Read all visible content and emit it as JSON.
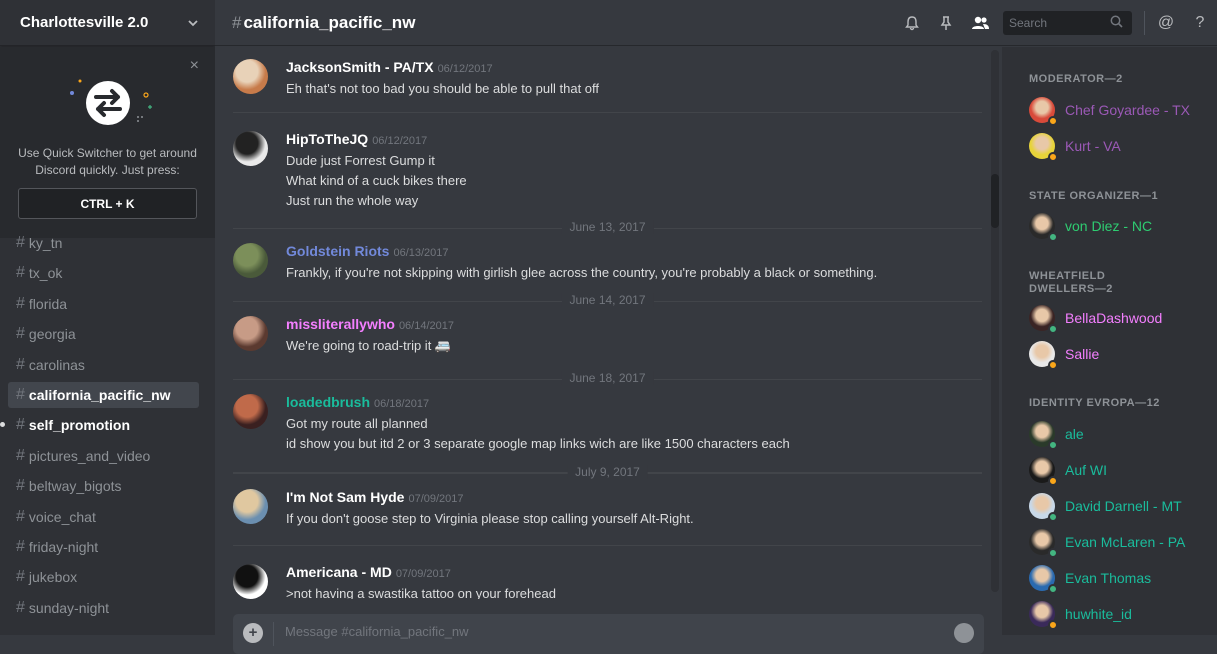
{
  "server": {
    "name": "Charlottesville 2.0"
  },
  "quick_switcher": {
    "text": "Use Quick Switcher to get around Discord quickly. Just press:",
    "shortcut": "CTRL + K",
    "close": "×"
  },
  "channels": [
    {
      "name": "ky_tn"
    },
    {
      "name": "tx_ok"
    },
    {
      "name": "florida"
    },
    {
      "name": "georgia"
    },
    {
      "name": "carolinas"
    },
    {
      "name": "california_pacific_nw",
      "active": true
    },
    {
      "name": "self_promotion",
      "unread": true
    },
    {
      "name": "pictures_and_video"
    },
    {
      "name": "beltway_bigots"
    },
    {
      "name": "voice_chat"
    },
    {
      "name": "friday-night"
    },
    {
      "name": "jukebox"
    },
    {
      "name": "sunday-night"
    }
  ],
  "header": {
    "hash": "#",
    "channel": "california_pacific_nw",
    "search_placeholder": "Search",
    "icons": [
      "bell-icon",
      "pin-icon",
      "members-icon",
      "search-icon",
      "at-icon",
      "help-icon"
    ],
    "at": "@",
    "help": "?"
  },
  "messages": [
    {
      "user": "JacksonSmith - PA/TX",
      "color": "#ffffff",
      "time": "06/12/2017",
      "lines": [
        "Eh that's not too bad you should be able to pull that off"
      ]
    },
    {
      "user": "HipToTheJQ",
      "color": "#ffffff",
      "time": "06/12/2017",
      "lines": [
        "Dude just Forrest Gump it",
        "What kind of a cuck bikes there",
        "Just run the whole way"
      ]
    },
    {
      "user": "Goldstein Riots",
      "color": "#7289da",
      "time": "06/13/2017",
      "lines": [
        "Frankly, if you're not skipping with girlish glee across the country, you're probably a black or something."
      ]
    },
    {
      "user": "missliterallywho",
      "color": "#f47fff",
      "time": "06/14/2017",
      "lines": [
        "We're going to road-trip it 🚐"
      ]
    },
    {
      "user": "loadedbrush",
      "color": "#1abc9c",
      "time": "06/18/2017",
      "lines": [
        "Got my route all planned",
        "id show you but itd 2 or 3 separate google map links wich are like 1500 characters each"
      ]
    },
    {
      "user": "I'm Not Sam Hyde",
      "color": "#ffffff",
      "time": "07/09/2017",
      "lines": [
        "If you don't goose step to Virginia please stop calling yourself Alt-Right."
      ]
    },
    {
      "user": "Americana - MD",
      "color": "#ffffff",
      "time": "07/09/2017",
      "lines": [
        ">not having a swastika tattoo on your forehead"
      ]
    }
  ],
  "date_dividers": [
    "June 13, 2017",
    "June 14, 2017",
    "June 18, 2017",
    "July 9, 2017"
  ],
  "input": {
    "placeholder": "Message #california_pacific_nw",
    "plus": "+"
  },
  "member_groups": [
    {
      "role": "MODERATOR—2",
      "members": [
        {
          "name": "Chef Goyardee - TX",
          "color": "#9b59b6",
          "status": "idle"
        },
        {
          "name": "Kurt - VA",
          "color": "#9b59b6",
          "status": "idle"
        }
      ]
    },
    {
      "role": "STATE ORGANIZER—1",
      "members": [
        {
          "name": "von Diez - NC",
          "color": "#2ecc71",
          "status": "online"
        }
      ]
    },
    {
      "role": "WHEATFIELD DWELLERS—2",
      "members": [
        {
          "name": "BellaDashwood",
          "color": "#f47fff",
          "status": "online"
        },
        {
          "name": "Sallie",
          "color": "#f47fff",
          "status": "idle"
        }
      ]
    },
    {
      "role": "IDENTITY EVROPA—12",
      "members": [
        {
          "name": "ale",
          "color": "#1abc9c",
          "status": "online"
        },
        {
          "name": "Auf WI",
          "color": "#1abc9c",
          "status": "idle"
        },
        {
          "name": "David Darnell - MT",
          "color": "#1abc9c",
          "status": "online"
        },
        {
          "name": "Evan McLaren - PA",
          "color": "#1abc9c",
          "status": "online"
        },
        {
          "name": "Evan Thomas",
          "color": "#1abc9c",
          "status": "online"
        },
        {
          "name": "huwhite_id",
          "color": "#1abc9c",
          "status": "idle"
        }
      ]
    }
  ],
  "colors": {
    "online": "#43b581",
    "idle": "#faa61a",
    "accent": "#7289da"
  }
}
